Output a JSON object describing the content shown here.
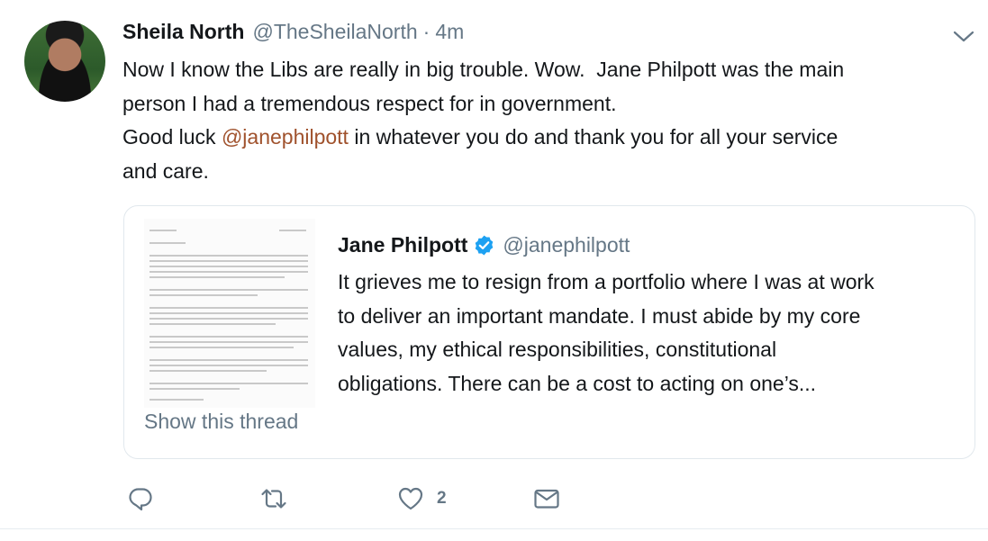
{
  "tweet": {
    "author_name": "Sheila North",
    "author_handle": "@TheSheilaNorth",
    "separator": "·",
    "time": "4m",
    "text_line1": "Now I know the Libs are really in big trouble. Wow.  Jane Philpott was the main",
    "text_line2": "person I had a tremendous respect for in government.",
    "text_line3_prefix": "Good luck ",
    "text_line3_mention": "@janephilpott",
    "text_line3_suffix": " in whatever you do and thank you for all your service",
    "text_line4": "and care."
  },
  "quote": {
    "author_name": "Jane Philpott",
    "author_handle": "@janephilpott",
    "text_line1": "It grieves me to resign from a portfolio where I was at work",
    "text_line2": "to deliver an important mandate. I must abide by my core",
    "text_line3": "values, my ethical responsibilities, constitutional",
    "text_line4": "obligations. There can be a cost to acting on one’s...",
    "show_thread": "Show this thread"
  },
  "actions": {
    "like_count": "2",
    "icons": [
      "reply-icon",
      "retweet-icon",
      "like-icon",
      "direct-message-icon"
    ]
  },
  "colors": {
    "text": "#14171a",
    "secondary": "#657786",
    "mention": "#a0522d",
    "verified": "#1da1f2",
    "border": "#e1e8ed"
  }
}
